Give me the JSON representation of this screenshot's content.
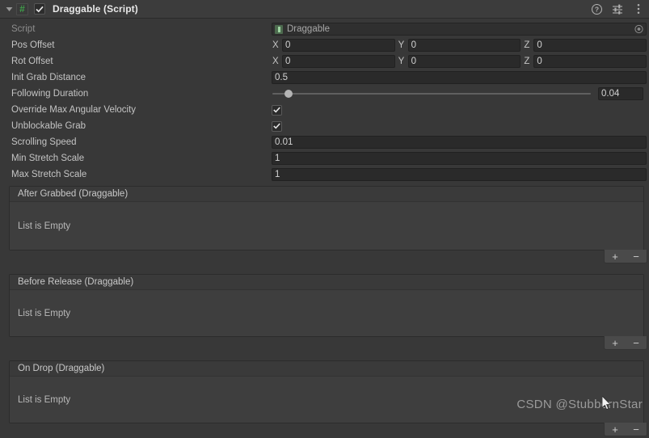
{
  "component": {
    "title": "Draggable (Script)",
    "icon": "csharp-script-icon",
    "enabled": true,
    "foldout_expanded": true,
    "header_icons": [
      "help-icon",
      "preset-icon",
      "more-menu-icon"
    ]
  },
  "fields": {
    "script": {
      "label": "Script",
      "value": "Draggable",
      "type": "object-field"
    },
    "pos_offset": {
      "label": "Pos Offset",
      "type": "vector3",
      "axes": [
        "X",
        "Y",
        "Z"
      ],
      "values": [
        "0",
        "0",
        "0"
      ]
    },
    "rot_offset": {
      "label": "Rot Offset",
      "type": "vector3",
      "axes": [
        "X",
        "Y",
        "Z"
      ],
      "values": [
        "0",
        "0",
        "0"
      ]
    },
    "init_grab_distance": {
      "label": "Init Grab Distance",
      "type": "float",
      "value": "0.5"
    },
    "following_duration": {
      "label": "Following Duration",
      "type": "slider",
      "value": "0.04",
      "knob_percent": 5
    },
    "override_max_angular_velocity": {
      "label": "Override Max Angular Velocity",
      "type": "bool",
      "checked": true
    },
    "unblockable_grab": {
      "label": "Unblockable Grab",
      "type": "bool",
      "checked": true
    },
    "scrolling_speed": {
      "label": "Scrolling Speed",
      "type": "float",
      "value": "0.01"
    },
    "min_stretch_scale": {
      "label": "Min Stretch Scale",
      "type": "float",
      "value": "1"
    },
    "max_stretch_scale": {
      "label": "Max Stretch Scale",
      "type": "float",
      "value": "1"
    }
  },
  "events": [
    {
      "title": "After Grabbed (Draggable)",
      "empty_text": "List is Empty",
      "add_label": "+",
      "remove_label": "−"
    },
    {
      "title": "Before Release (Draggable)",
      "empty_text": "List is Empty",
      "add_label": "+",
      "remove_label": "−"
    },
    {
      "title": "On Drop (Draggable)",
      "empty_text": "List is Empty",
      "add_label": "+",
      "remove_label": "−"
    }
  ],
  "watermark": "CSDN @StubbornStar",
  "colors": {
    "background": "#383838",
    "header": "#3c3c3c",
    "input_bg": "#2a2a2a",
    "list_bg": "#3e3e3e",
    "script_icon_green": "#3f9c4a",
    "text": "#c4c4c4"
  }
}
